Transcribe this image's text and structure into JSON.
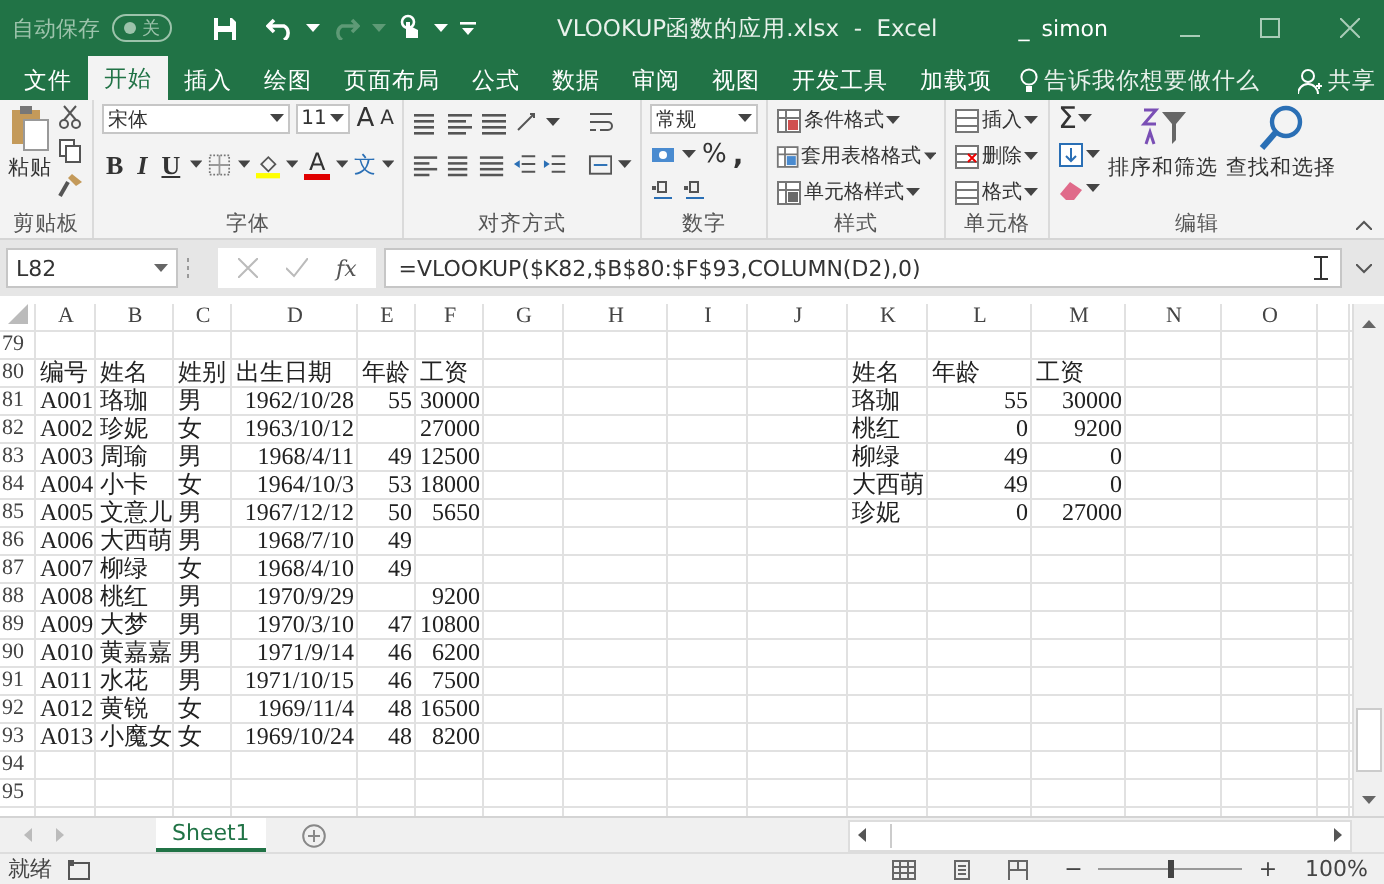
{
  "title_bar": {
    "autosave": {
      "label": "自动保存",
      "state": "关",
      "on": false
    },
    "document_title": "VLOOKUP函数的应用.xlsx  -  Excel",
    "user_mark": "_",
    "user": "simon"
  },
  "ribbon_tabs": [
    {
      "label": "文件",
      "selected": false
    },
    {
      "label": "开始",
      "selected": true
    },
    {
      "label": "插入",
      "selected": false
    },
    {
      "label": "绘图",
      "selected": false
    },
    {
      "label": "页面布局",
      "selected": false
    },
    {
      "label": "公式",
      "selected": false
    },
    {
      "label": "数据",
      "selected": false
    },
    {
      "label": "审阅",
      "selected": false
    },
    {
      "label": "视图",
      "selected": false
    },
    {
      "label": "开发工具",
      "selected": false
    },
    {
      "label": "加载项",
      "selected": false
    }
  ],
  "tell_me": "告诉我你想要做什么",
  "share": "共享",
  "ribbon": {
    "clipboard": {
      "paste": "粘贴",
      "label": "剪贴板"
    },
    "font": {
      "name": "宋体",
      "size": "11",
      "grow": "A",
      "shrink": "A",
      "bold": "B",
      "italic": "I",
      "underline": "U",
      "font_color": "A",
      "phonetic": "文",
      "label": "字体"
    },
    "alignment": {
      "label": "对齐方式"
    },
    "number": {
      "format": "常规",
      "percent": "%",
      "comma": ",",
      "label": "数字"
    },
    "styles": {
      "items": [
        "条件格式",
        "套用表格格式",
        "单元格样式"
      ],
      "label": "样式"
    },
    "cells": {
      "items": [
        "插入",
        "删除",
        "格式"
      ],
      "label": "单元格"
    },
    "editing": {
      "autosum": "Σ",
      "sort": "排序和筛选",
      "find": "查找和选择",
      "label": "编辑"
    }
  },
  "formula_bar": {
    "name_box": "L82",
    "fx": "fx",
    "formula": "=VLOOKUP($K82,$B$80:$F$93,COLUMN(D2),0)"
  },
  "sheet": {
    "columns": [
      "A",
      "B",
      "C",
      "D",
      "E",
      "F",
      "G",
      "H",
      "I",
      "J",
      "K",
      "L",
      "M",
      "N",
      "O"
    ],
    "rows": [
      {
        "number": "79",
        "cells": []
      },
      {
        "number": "80",
        "cells": [
          "编号",
          "姓名",
          "姓别",
          "出生日期",
          "年龄",
          "工资",
          "",
          "",
          "",
          "",
          "姓名",
          "年龄",
          "工资"
        ]
      },
      {
        "number": "81",
        "cells": [
          "A001",
          "珞珈",
          "男",
          "1962/10/28",
          "55",
          "30000",
          "",
          "",
          "",
          "",
          "珞珈",
          "55",
          "30000"
        ]
      },
      {
        "number": "82",
        "cells": [
          "A002",
          "珍妮",
          "女",
          "1963/10/12",
          "",
          "27000",
          "",
          "",
          "",
          "",
          "桃红",
          "0",
          "9200"
        ]
      },
      {
        "number": "83",
        "cells": [
          "A003",
          "周瑜",
          "男",
          "1968/4/11",
          "49",
          "12500",
          "",
          "",
          "",
          "",
          "柳绿",
          "49",
          "0"
        ]
      },
      {
        "number": "84",
        "cells": [
          "A004",
          "小卡",
          "女",
          "1964/10/3",
          "53",
          "18000",
          "",
          "",
          "",
          "",
          "大西萌",
          "49",
          "0"
        ]
      },
      {
        "number": "85",
        "cells": [
          "A005",
          "文意儿",
          "男",
          "1967/12/12",
          "50",
          "5650",
          "",
          "",
          "",
          "",
          "珍妮",
          "0",
          "27000"
        ]
      },
      {
        "number": "86",
        "cells": [
          "A006",
          "大西萌",
          "男",
          "1968/7/10",
          "49"
        ]
      },
      {
        "number": "87",
        "cells": [
          "A007",
          "柳绿",
          "女",
          "1968/4/10",
          "49"
        ]
      },
      {
        "number": "88",
        "cells": [
          "A008",
          "桃红",
          "男",
          "1970/9/29",
          "",
          "9200"
        ]
      },
      {
        "number": "89",
        "cells": [
          "A009",
          "大梦",
          "男",
          "1970/3/10",
          "47",
          "10800"
        ]
      },
      {
        "number": "90",
        "cells": [
          "A010",
          "黄嘉嘉",
          "男",
          "1971/9/14",
          "46",
          "6200"
        ]
      },
      {
        "number": "91",
        "cells": [
          "A011",
          "水花",
          "男",
          "1971/10/15",
          "46",
          "7500"
        ]
      },
      {
        "number": "92",
        "cells": [
          "A012",
          "黄锐",
          "女",
          "1969/11/4",
          "48",
          "16500"
        ]
      },
      {
        "number": "93",
        "cells": [
          "A013",
          "小魔女",
          "女",
          "1969/10/24",
          "48",
          "8200"
        ]
      },
      {
        "number": "94",
        "cells": []
      },
      {
        "number": "95",
        "cells": []
      }
    ]
  },
  "sheet_tabs": [
    {
      "label": "Sheet1",
      "selected": true
    }
  ],
  "status_bar": {
    "status": "就绪",
    "zoom": {
      "out": "−",
      "in": "+",
      "level": 0.5,
      "reading": "100%"
    }
  }
}
